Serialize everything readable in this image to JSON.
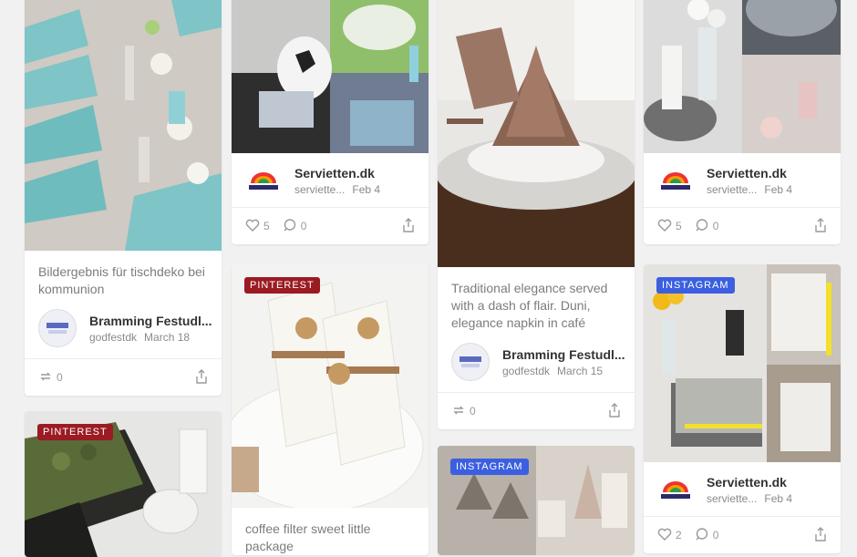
{
  "cards": {
    "c1": {
      "caption": "Bildergebnis für tischdeko bei kommunion",
      "author": "Bramming Festudl...",
      "handle": "godfestdk",
      "date": "March 18",
      "reposts": "0"
    },
    "c2": {
      "author": "Servietten.dk",
      "handle": "serviette...",
      "date": "Feb 4",
      "likes": "5",
      "comments": "0"
    },
    "c3": {
      "badge": "PINTEREST"
    },
    "c4": {
      "badge": "PINTEREST",
      "caption": "coffee filter sweet little package"
    },
    "c5": {
      "caption": "Traditional elegance served with a dash of flair. Duni, elegance napkin in café",
      "author": "Bramming Festudl...",
      "handle": "godfestdk",
      "date": "March 15",
      "reposts": "0"
    },
    "c6": {
      "badge": "INSTAGRAM"
    },
    "c7": {
      "author": "Servietten.dk",
      "handle": "serviette...",
      "date": "Feb 4",
      "likes": "5",
      "comments": "0"
    },
    "c8": {
      "badge": "INSTAGRAM",
      "author": "Servietten.dk",
      "handle": "serviette...",
      "date": "Feb 4",
      "likes": "2",
      "comments": "0"
    }
  },
  "colors": {
    "pinterest": "#9b1b22",
    "instagram": "#3b5fe0"
  },
  "icons": [
    "heart-icon",
    "comment-icon",
    "repost-icon",
    "share-icon"
  ]
}
